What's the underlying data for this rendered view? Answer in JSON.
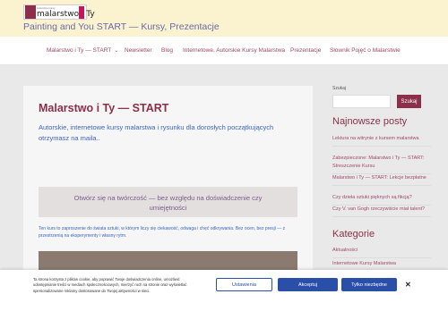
{
  "header": {
    "logo": {
      "small_text": "Autorskie kursy",
      "text": "malarstwo i Ty"
    },
    "tagline": "Painting and You START — Kursy, Prezentacje"
  },
  "nav": {
    "items": [
      {
        "label": "Malarstwo i Ty — START",
        "has_dropdown": true
      },
      {
        "label": "Newsletter"
      },
      {
        "label": "Blog"
      },
      {
        "label": "Internetowe, Autorskie Kursy Malarstwa"
      },
      {
        "label": "Prezentacje"
      },
      {
        "label": "Słownik Pojęć o Malarstwie"
      }
    ]
  },
  "main": {
    "title": "Malarstwo i Ty — START",
    "intro": "Autorskie, internetowe kursy malarstwa i rysunku dla dorosłych początkujących otrzymasz na maila..",
    "quote": "Otwórz się na twórczość — bez względu na doświadczenie czy umiejętności",
    "sub_text": "Ten kurs to zaproszenie do świata sztuki, w którym liczy się ciekawość, odwaga i chęć odkrywania. Bez ocen, bez presji — z przestrzenią na eksperymenty i własny rytm."
  },
  "sidebar": {
    "search_label": "Szukaj",
    "search_placeholder": "",
    "search_button": "Szukaj",
    "recent_heading": "Najnowsze posty",
    "recent_posts": [
      "Lektura na witrynie z kursem malarstwa",
      "Zabezpieczone: Malarstwo i Ty — START: Streszczenie Kursu",
      "Malarstwo i Ty — START: Lekcje bezpłatne",
      "Czy dzieła sztuki pięknych są fikcją?",
      "Czy V. van Gogh rzeczywiście miał talent?"
    ],
    "categories_heading": "Kategorie",
    "categories": [
      "Aktualności",
      "Internetowe Kursy Malarstwa"
    ]
  },
  "cookie": {
    "text": "Ta strona korzysta z plików cookie, aby poprawić Twoje doświadczenia online, umożliwić udostępnianie treści w mediach społecznościowych, mierzyć ruch na stronie oraz wyświetlać spersonalizowane reklamy dostosowane do Twojej aktywności w sieci.",
    "settings_label": "Ustawienia",
    "accept_label": "Akceptuj",
    "necessary_label": "Tylko niezbędne",
    "close_label": "✕"
  },
  "colors": {
    "header_bg": "#fbf2cf",
    "accent": "#8b2f4a",
    "link": "#a0496a",
    "intro_text": "#3c64c0",
    "button_blue": "#2a4fa8"
  }
}
